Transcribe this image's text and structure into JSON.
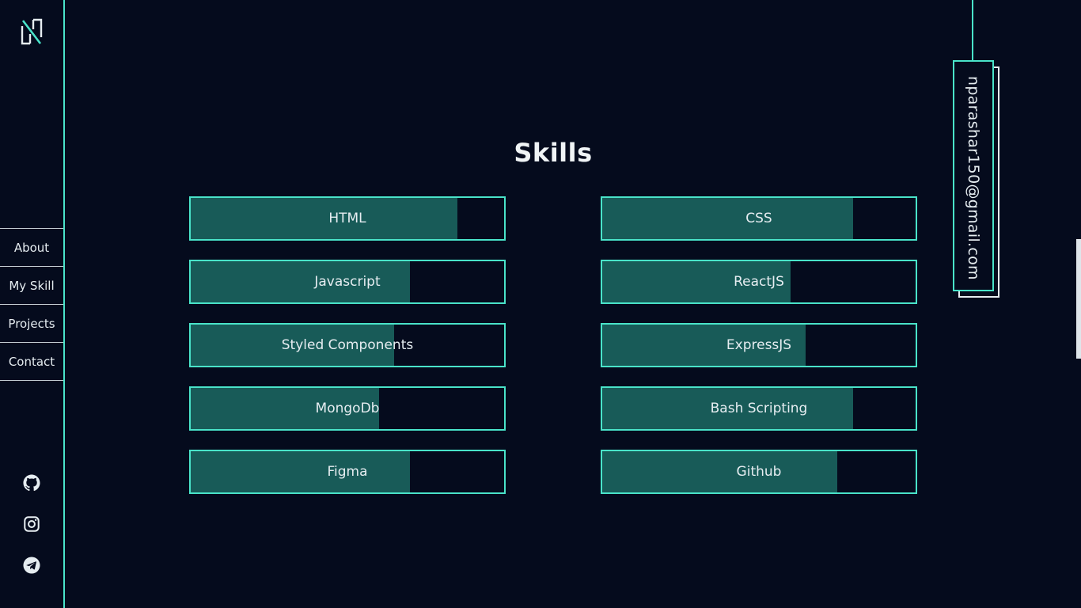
{
  "logo": {
    "icon": "logo-monogram-icon",
    "accent": "#49e3c9"
  },
  "nav": {
    "items": [
      {
        "label": "About"
      },
      {
        "label": "My Skill"
      },
      {
        "label": "Projects"
      },
      {
        "label": "Contact"
      }
    ]
  },
  "social": [
    "github-icon",
    "instagram-icon",
    "telegram-icon"
  ],
  "main": {
    "title": "Skills"
  },
  "skills": [
    {
      "label": "HTML",
      "level": 0.85
    },
    {
      "label": "CSS",
      "level": 0.8
    },
    {
      "label": "Javascript",
      "level": 0.7
    },
    {
      "label": "ReactJS",
      "level": 0.6
    },
    {
      "label": "Styled Components",
      "level": 0.65
    },
    {
      "label": "ExpressJS",
      "level": 0.65
    },
    {
      "label": "MongoDb",
      "level": 0.6
    },
    {
      "label": "Bash Scripting",
      "level": 0.8
    },
    {
      "label": "Figma",
      "level": 0.7
    },
    {
      "label": "Github",
      "level": 0.75
    }
  ],
  "email": {
    "address": "nparashar150@gmail.com"
  },
  "colors": {
    "background": "#050b1d",
    "accent": "#49e3c9",
    "fill": "#185b58",
    "text": "#e6edf1"
  }
}
